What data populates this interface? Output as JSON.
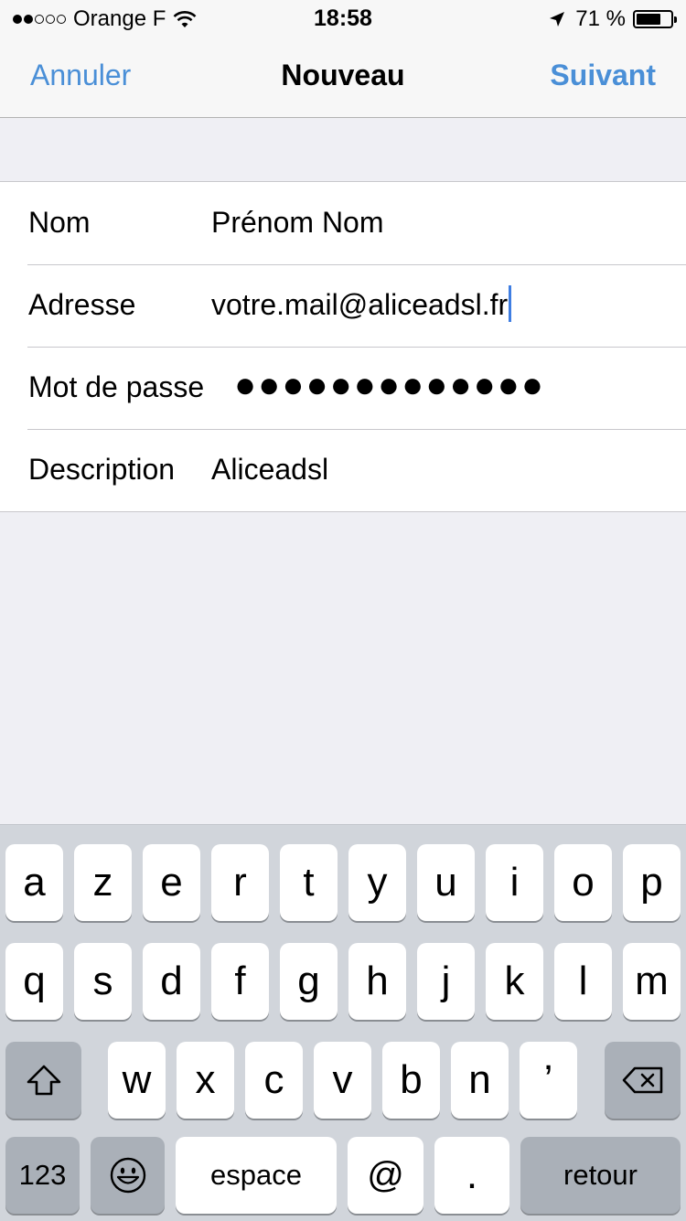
{
  "status_bar": {
    "carrier": "Orange F",
    "time": "18:58",
    "battery_percent": "71 %",
    "battery_level": 0.71,
    "signal_bars": 2
  },
  "nav": {
    "cancel": "Annuler",
    "title": "Nouveau",
    "next": "Suivant"
  },
  "form": {
    "name_label": "Nom",
    "name_value": "Prénom Nom",
    "address_label": "Adresse",
    "address_value": "votre.mail@aliceadsl.fr",
    "password_label": "Mot de passe",
    "password_value": "●●●●●●●●●●●●●",
    "description_label": "Description",
    "description_value": "Aliceadsl"
  },
  "keyboard": {
    "row1": [
      "a",
      "z",
      "e",
      "r",
      "t",
      "y",
      "u",
      "i",
      "o",
      "p"
    ],
    "row2": [
      "q",
      "s",
      "d",
      "f",
      "g",
      "h",
      "j",
      "k",
      "l",
      "m"
    ],
    "row3": [
      "w",
      "x",
      "c",
      "v",
      "b",
      "n",
      "’"
    ],
    "numbers": "123",
    "space": "espace",
    "at": "@",
    "dot": ".",
    "return": "retour"
  },
  "colors": {
    "accent": "#4a8fd7",
    "caret": "#3f7ee2",
    "keyboard_bg": "#d1d5db"
  }
}
